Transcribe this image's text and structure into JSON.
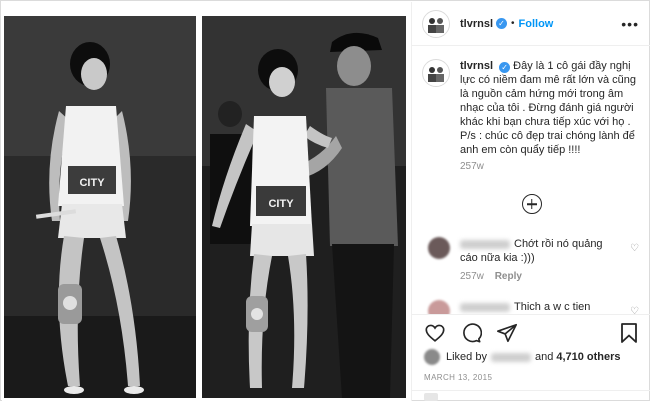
{
  "post": {
    "username": "tlvrnsl",
    "follow_label": "Follow",
    "separator": "•",
    "more_label": "•••",
    "caption": "Đây là 1 cô gái đầy nghị lực có niềm đam mê rất lớn và cũng là nguồn cảm hứng mới trong âm nhạc của tôi . Đừng đánh giá người khác khi bạn chưa tiếp xúc với họ . P/s : chúc cô đẹp trai chóng lành để anh em còn quẩy tiếp !!!!",
    "caption_time": "257w"
  },
  "photos": {
    "left_shirt_text": "CITY",
    "right_shirt_text": "CITY"
  },
  "comments": [
    {
      "text": "Chớt rồi nó quảng cáo nữa kia :)))",
      "time": "257w",
      "reply_label": "Reply",
      "avatar_color": "#6b5a5a"
    },
    {
      "text": "Thich a w c tien",
      "avatar_color": "#c99a9a"
    }
  ],
  "likes": {
    "prefix": "Liked by",
    "conjunction": "and",
    "count": "4,710 others"
  },
  "date": "MARCH 13, 2015",
  "icons": {
    "like": "heart-icon",
    "comment": "comment-icon",
    "share": "share-icon",
    "save": "bookmark-icon"
  },
  "colors": {
    "link": "#0095f6",
    "verified": "#3897f0",
    "muted": "#8e8e8e"
  }
}
